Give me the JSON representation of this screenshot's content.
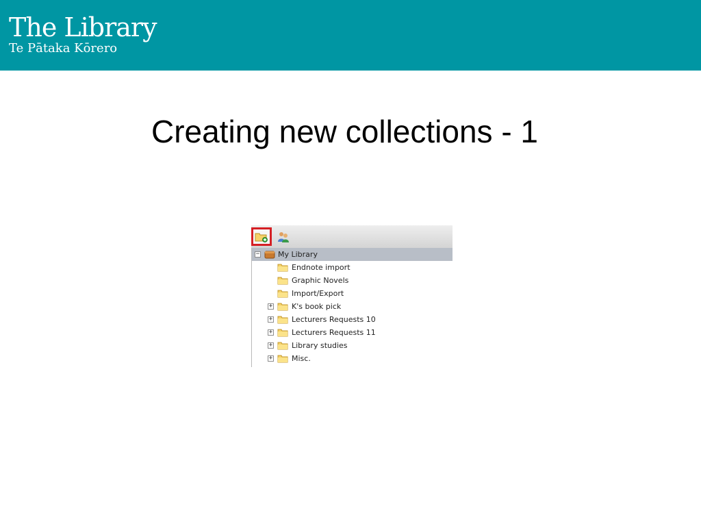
{
  "header": {
    "logo_title": "The Library",
    "logo_subtitle": "Te Pātaka Kōrero",
    "color": "#0096a3"
  },
  "slide": {
    "title": "Creating new collections - 1"
  },
  "toolbar": {
    "buttons": [
      {
        "icon": "new-collection-icon",
        "highlighted": true,
        "highlight_color": "#d51f24"
      },
      {
        "icon": "share-users-icon",
        "highlighted": false
      }
    ]
  },
  "tree": {
    "root": {
      "label": "My Library",
      "expanded": true
    },
    "items": [
      {
        "label": "Endnote import",
        "expandable": false
      },
      {
        "label": "Graphic Novels",
        "expandable": false
      },
      {
        "label": "Import/Export",
        "expandable": false
      },
      {
        "label": "K's book pick",
        "expandable": true
      },
      {
        "label": "Lecturers Requests 10",
        "expandable": true
      },
      {
        "label": "Lecturers Requests 11",
        "expandable": true
      },
      {
        "label": "Library studies",
        "expandable": true
      },
      {
        "label": "Misc.",
        "expandable": true
      }
    ]
  }
}
